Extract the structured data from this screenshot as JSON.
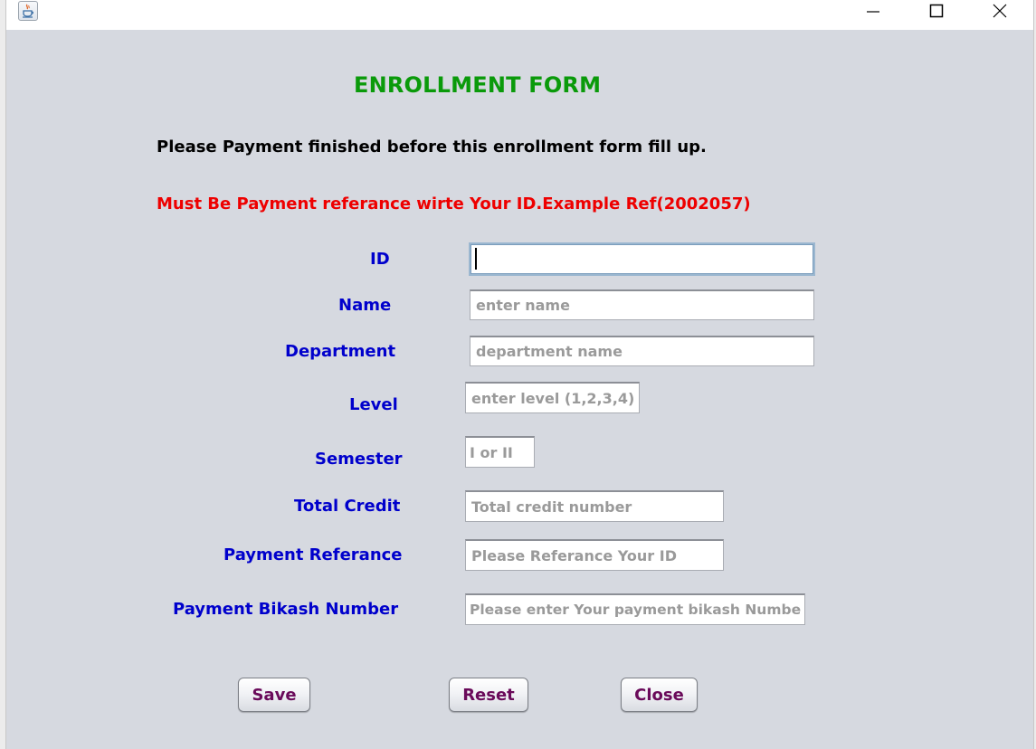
{
  "window": {
    "icon": "java-cup-icon",
    "controls": {
      "minimize": "minimize-icon",
      "maximize": "maximize-icon",
      "close": "close-icon"
    }
  },
  "form": {
    "title": "ENROLLMENT FORM",
    "notice": "Please Payment finished before this enrollment form fill up.",
    "warning": "Must Be Payment referance wirte Your ID.Example Ref(2002057)",
    "fields": {
      "id": {
        "label": "ID",
        "value": "",
        "placeholder": ""
      },
      "name": {
        "label": "Name",
        "value": "",
        "placeholder": "enter name"
      },
      "department": {
        "label": "Department",
        "value": "",
        "placeholder": "department name"
      },
      "level": {
        "label": "Level",
        "value": "",
        "placeholder": "enter level (1,2,3,4)"
      },
      "semester": {
        "label": "Semester",
        "value": "",
        "placeholder": "I or II"
      },
      "total_credit": {
        "label": "Total Credit",
        "value": "",
        "placeholder": "Total credit number"
      },
      "payment_reference": {
        "label": "Payment Referance",
        "value": "",
        "placeholder": "Please Referance Your ID"
      },
      "bikash_number": {
        "label": "Payment Bikash Number",
        "value": "",
        "placeholder": "Please enter Your payment bikash Number"
      }
    },
    "buttons": {
      "save": "Save",
      "reset": "Reset",
      "close": "Close"
    }
  },
  "colors": {
    "title": "#0a9a0a",
    "notice": "#000000",
    "warning": "#ee0000",
    "labels": "#0000cc",
    "button_text": "#6a0a5a",
    "background": "#d6d9e0"
  }
}
